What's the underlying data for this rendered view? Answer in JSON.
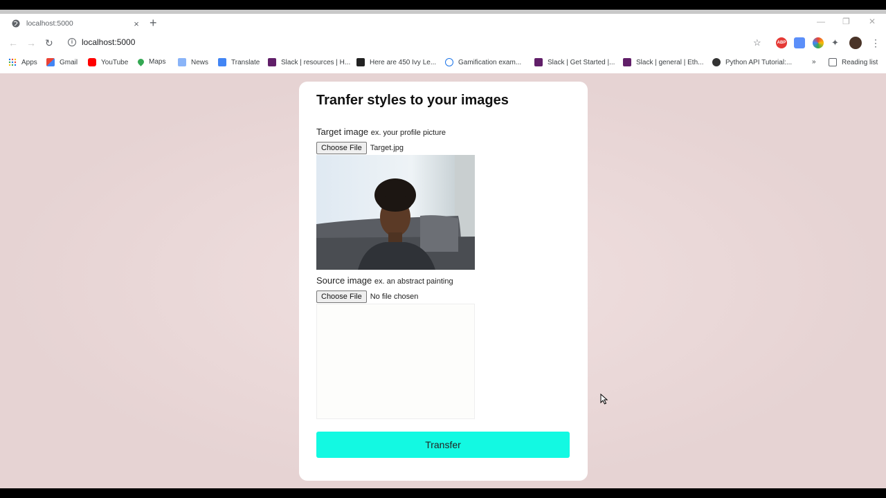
{
  "browser": {
    "tab_title": "localhost:5000",
    "url": "localhost:5000",
    "bookmarks": [
      {
        "label": "Apps",
        "icon": "apps-grid-icon"
      },
      {
        "label": "Gmail",
        "icon": "gmail-icon"
      },
      {
        "label": "YouTube",
        "icon": "youtube-icon"
      },
      {
        "label": "Maps",
        "icon": "maps-icon"
      },
      {
        "label": "News",
        "icon": "news-icon"
      },
      {
        "label": "Translate",
        "icon": "translate-icon"
      },
      {
        "label": "Slack | resources | H...",
        "icon": "slack-icon"
      },
      {
        "label": "Here are 450 Ivy Le...",
        "icon": "class-central-icon"
      },
      {
        "label": "Gamification exam...",
        "icon": "circle-icon"
      },
      {
        "label": "Slack | Get Started |...",
        "icon": "slack-icon"
      },
      {
        "label": "Slack | general | Eth...",
        "icon": "slack-icon"
      },
      {
        "label": "Python API Tutorial:...",
        "icon": "python-icon"
      }
    ],
    "overflow": "»",
    "reading_list": "Reading list"
  },
  "app": {
    "title": "Tranfer styles to your images",
    "target": {
      "label": "Target image",
      "hint": "ex. your profile picture",
      "button": "Choose File",
      "filename": "Target.jpg"
    },
    "source": {
      "label": "Source image",
      "hint": "ex. an abstract painting",
      "button": "Choose File",
      "filename": "No file chosen"
    },
    "transfer_button": "Transfer"
  },
  "colors": {
    "accent": "#13f9e2",
    "background": "#e6d3d3"
  }
}
